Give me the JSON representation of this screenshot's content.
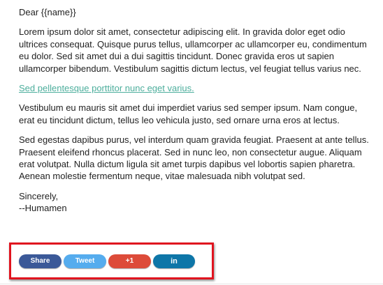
{
  "email": {
    "greeting": "Dear {{name}}",
    "paragraphs": [
      "Lorem ipsum dolor sit amet, consectetur adipiscing elit. In gravida dolor eget odio ultrices consequat. Quisque purus tellus, ullamcorper ac ullamcorper eu, condimentum eu dolor. Sed sit amet dui a dui sagittis tincidunt. Donec gravida eros ut sapien ullamcorper bibendum. Vestibulum sagittis dictum lectus, vel feugiat tellus varius nec.",
      "Vestibulum eu mauris sit amet dui imperdiet varius sed semper ipsum. Nam congue, erat eu tincidunt dictum, tellus leo vehicula justo, sed ornare urna eros at lectus.",
      "Sed egestas dapibus purus, vel interdum quam gravida feugiat. Praesent at ante tellus. Praesent eleifend rhoncus placerat. Sed in nunc leo, non consectetur augue. Aliquam erat volutpat. Nulla dictum ligula sit amet turpis dapibus vel lobortis sapien pharetra. Aenean molestie fermentum neque, vitae malesuada nibh volutpat sed."
    ],
    "link_text": "Sed pellentesque porttitor nunc eget varius.",
    "signoff": "Sincerely,",
    "signature": "--Humamen"
  },
  "share_buttons": {
    "facebook_label": "Share",
    "twitter_label": "Tweet",
    "gplus_label": "+1",
    "linkedin_label": "in"
  },
  "colors": {
    "link": "#4cae9c",
    "highlight_border": "#e0141f",
    "facebook": "#3b5998",
    "twitter": "#55acee",
    "gplus": "#dd4b39",
    "linkedin": "#0e76a8"
  }
}
